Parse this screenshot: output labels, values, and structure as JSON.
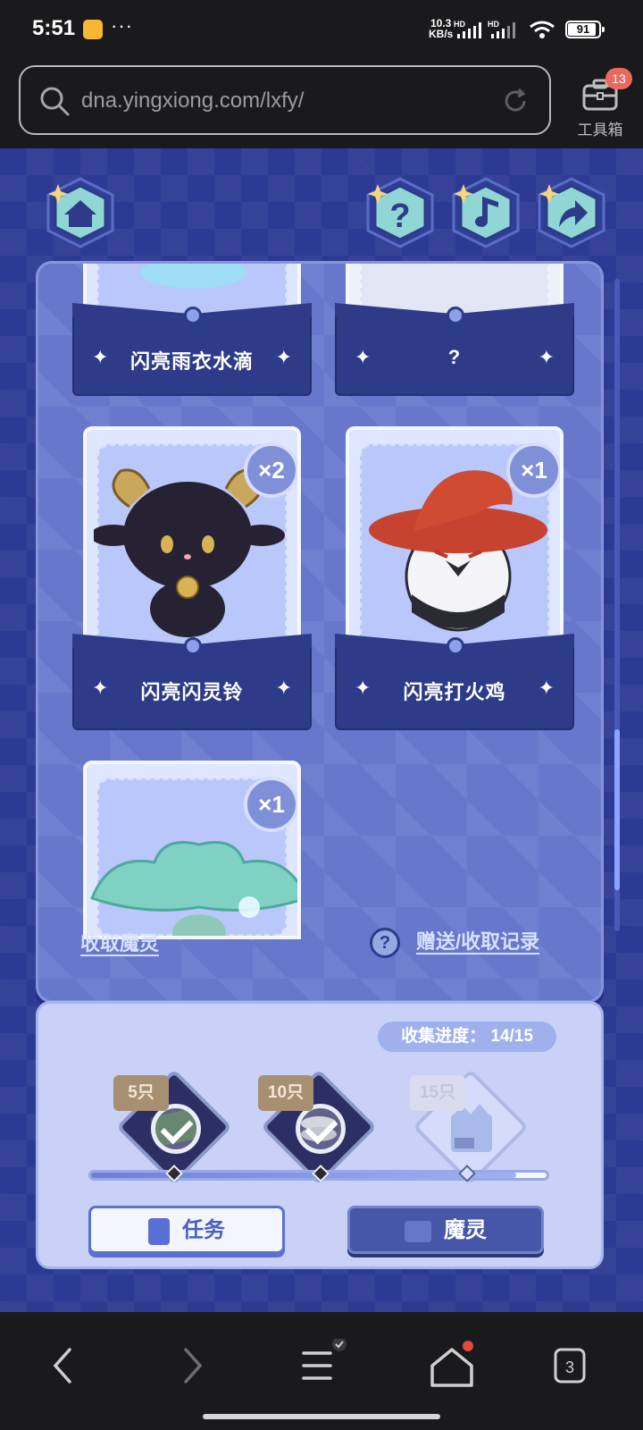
{
  "status_bar": {
    "time": "5:51",
    "more": "···",
    "net_speed_value": "10.3",
    "net_speed_unit": "KB/s",
    "signal_1": "HD",
    "signal_2": "HD",
    "battery": "91",
    "battery_level": 91
  },
  "browser": {
    "url": "dna.yingxiong.com/lxfy/",
    "toolbox_label": "工具箱",
    "toolbox_badge": "13"
  },
  "cards": [
    {
      "label": "闪亮雨衣水滴"
    },
    {
      "label": "?"
    },
    {
      "label": "闪亮闪灵铃",
      "count": "×2"
    },
    {
      "label": "闪亮打火鸡",
      "count": "×1"
    },
    {
      "count": "×1"
    }
  ],
  "links": {
    "collect": "收取魔灵",
    "record_icon": "?",
    "record": "赠送/收取记录"
  },
  "progress": {
    "label": "收集进度： 14/15",
    "collected": 14,
    "total": 15,
    "milestones": [
      {
        "tag": "5只",
        "done": true
      },
      {
        "tag": "10只",
        "done": true
      },
      {
        "tag": "15只",
        "done": false
      }
    ]
  },
  "tabs": {
    "task": "任务",
    "spirit": "魔灵"
  },
  "nav": {
    "tabs_count": "3"
  },
  "colors": {
    "page_bg": "#2d3a93",
    "panel_bg": "#6777cc",
    "sleeve": "#2d3b88",
    "accent_badge": "#e96a5c"
  }
}
